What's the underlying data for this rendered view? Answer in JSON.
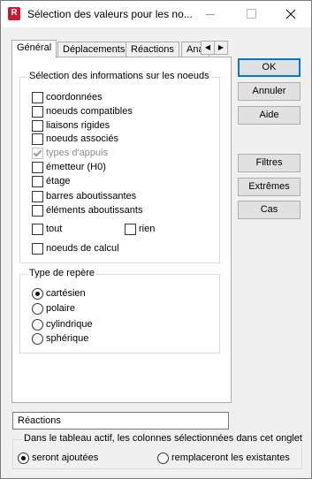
{
  "window": {
    "title": "Sélection des valeurs pour les no...",
    "app_icon_letter": "R"
  },
  "tabs": [
    {
      "label": "Général"
    },
    {
      "label": "Déplacements"
    },
    {
      "label": "Réactions"
    },
    {
      "label": "Ana"
    }
  ],
  "info_group": {
    "title": "Sélection des informations sur les noeuds",
    "items": [
      {
        "label": "coordonnées",
        "checked": false,
        "disabled": false
      },
      {
        "label": "noeuds compatibles",
        "checked": false,
        "disabled": false
      },
      {
        "label": "liaisons rigides",
        "checked": false,
        "disabled": false
      },
      {
        "label": "noeuds associés",
        "checked": false,
        "disabled": false
      },
      {
        "label": "types d'appuis",
        "checked": true,
        "disabled": true
      },
      {
        "label": "émetteur (H0)",
        "checked": false,
        "disabled": false
      },
      {
        "label": "étage",
        "checked": false,
        "disabled": false
      },
      {
        "label": "barres aboutissantes",
        "checked": false,
        "disabled": false
      },
      {
        "label": "éléments aboutissants",
        "checked": false,
        "disabled": false
      }
    ],
    "tout_label": "tout",
    "rien_label": "rien",
    "calc_label": "noeuds de calcul"
  },
  "repere_group": {
    "title": "Type de repère",
    "options": [
      {
        "label": "cartésien",
        "selected": true
      },
      {
        "label": "polaire",
        "selected": false
      },
      {
        "label": "cylindrique",
        "selected": false
      },
      {
        "label": "sphérique",
        "selected": false
      }
    ]
  },
  "buttons": {
    "ok": "OK",
    "annuler": "Annuler",
    "aide": "Aide",
    "filtres": "Filtres",
    "extremes": "Extrêmes",
    "cas": "Cas"
  },
  "name_field": {
    "value": "Réactions"
  },
  "bottom": {
    "title": "Dans le tableau actif, les colonnes sélectionnées dans cet onglet",
    "option1": "seront ajoutées",
    "option2": "remplaceront les existantes",
    "selected": "option1"
  }
}
